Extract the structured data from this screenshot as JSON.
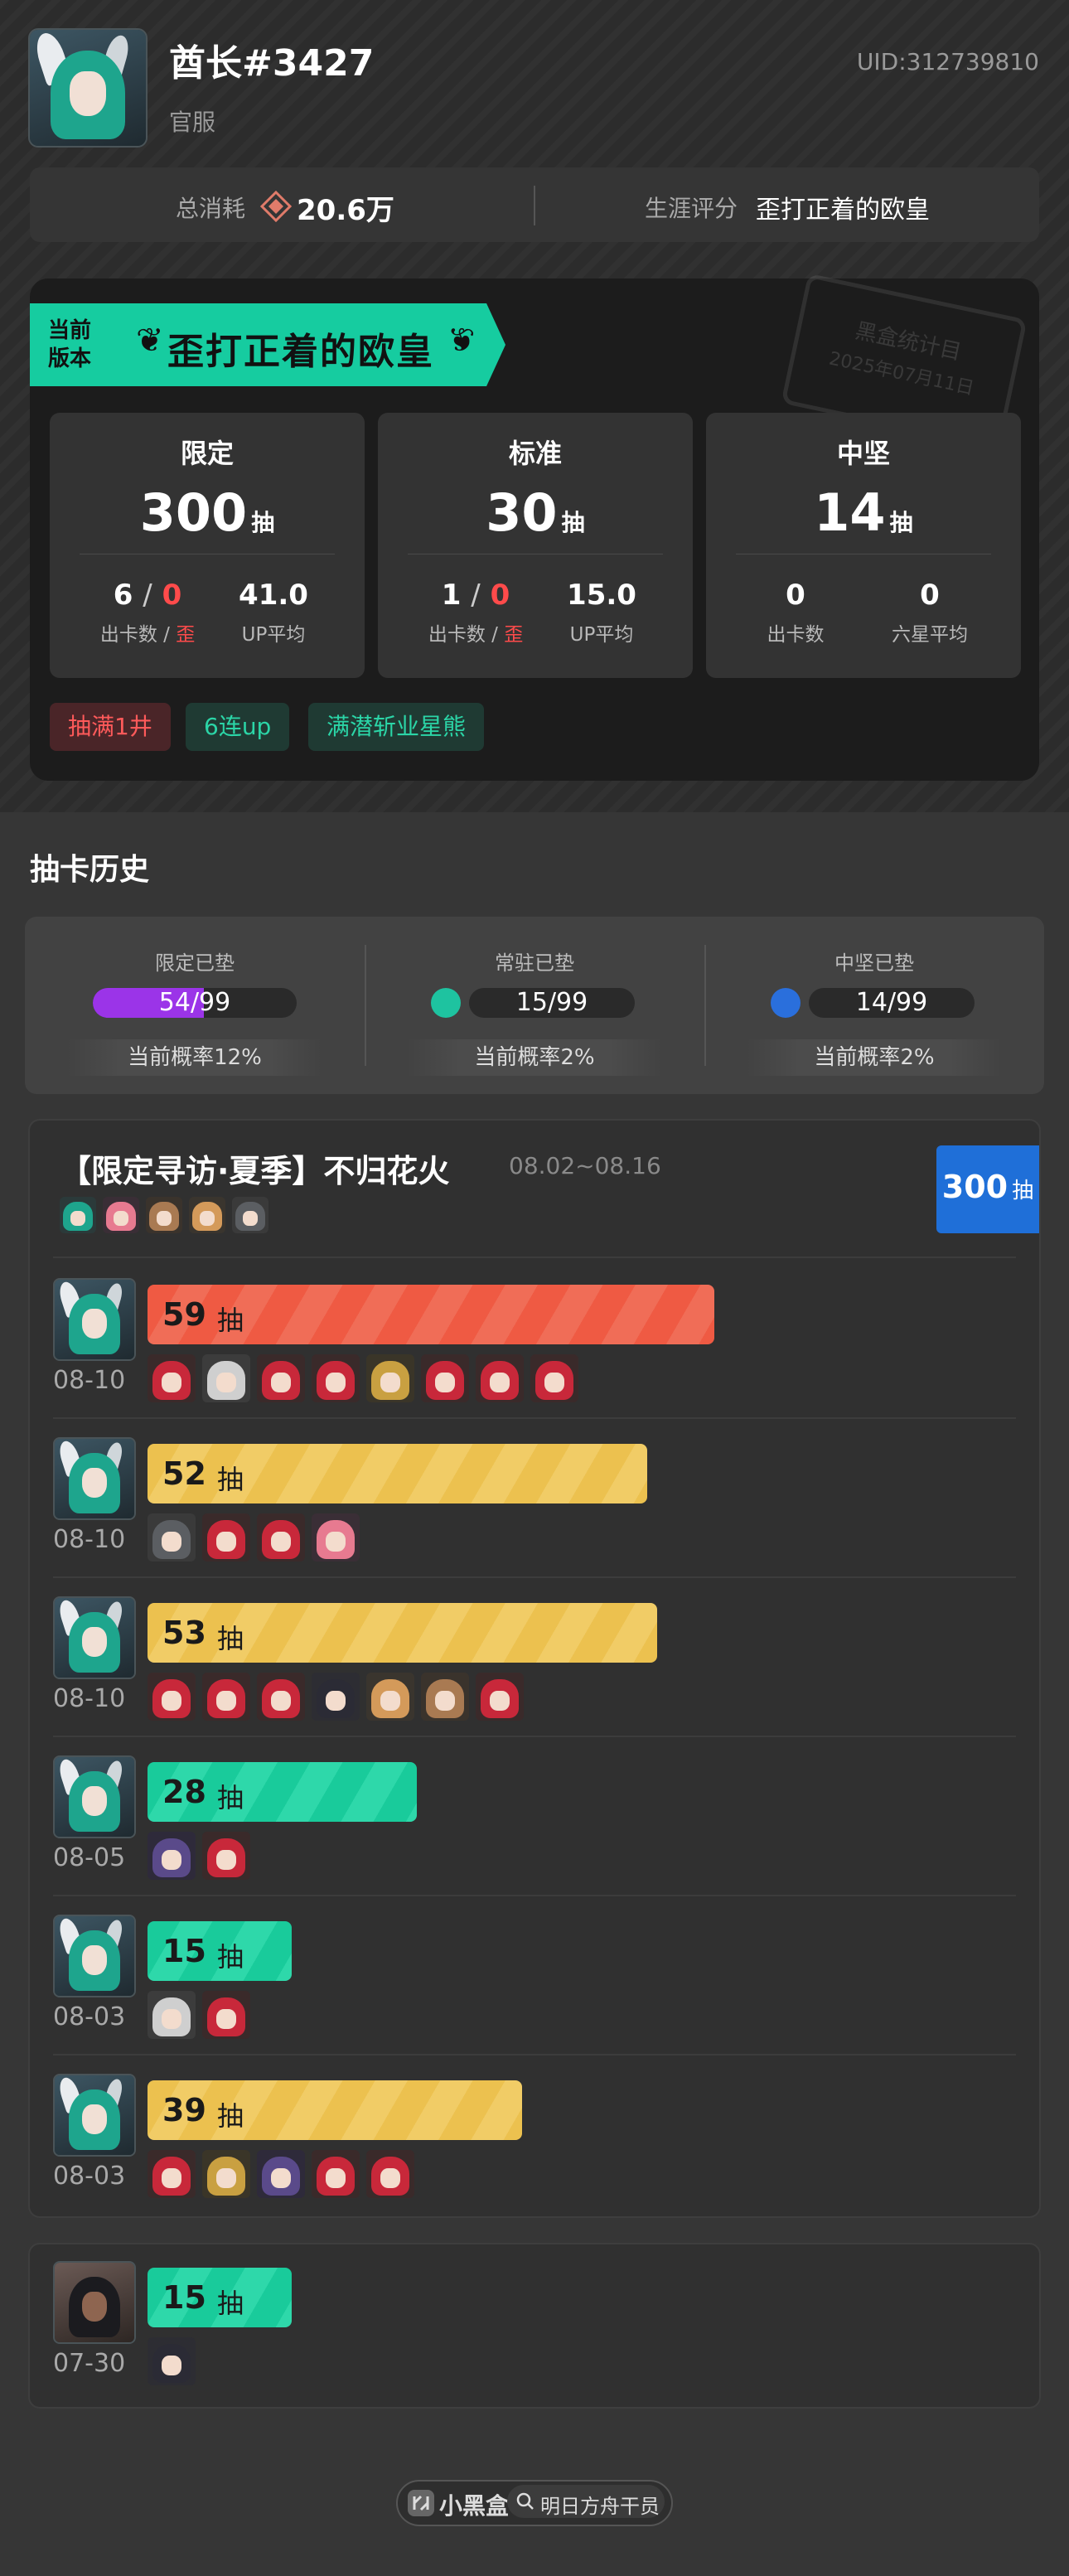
{
  "profile": {
    "nickname": "酋长#3427",
    "server": "官服",
    "uid": "UID:312739810",
    "total_spent_label": "总消耗",
    "total_spent_value": "20.6万",
    "career_label": "生涯评分",
    "career_value": "歪打正着的欧皇"
  },
  "version_card": {
    "current_label_line1": "当前",
    "current_label_line2": "版本",
    "title": "歪打正着的欧皇",
    "stamp_line1": "黑盒统计目",
    "stamp_line2": "2025年07月11日",
    "pools": [
      {
        "name": "限定",
        "count": "300",
        "unit": "抽",
        "a_val": "6",
        "a_red": "0",
        "a_sep": "/",
        "a_lbl": "出卡数",
        "a_lbl_red": "歪",
        "b_val": "41.0",
        "b_lbl": "UP平均"
      },
      {
        "name": "标准",
        "count": "30",
        "unit": "抽",
        "a_val": "1",
        "a_red": "0",
        "a_sep": "/",
        "a_lbl": "出卡数",
        "a_lbl_red": "歪",
        "b_val": "15.0",
        "b_lbl": "UP平均"
      },
      {
        "name": "中坚",
        "count": "14",
        "unit": "抽",
        "a_val": "0",
        "a_lbl": "出卡数",
        "b_val": "0",
        "b_lbl": "六星平均"
      }
    ],
    "tags": [
      "抽满1井",
      "6连up",
      "满潜斩业星熊"
    ]
  },
  "history": {
    "title": "抽卡历史",
    "pity": [
      {
        "label": "限定已垫",
        "value": "54/99",
        "ratio": 0.545,
        "color": "#9b34e8",
        "prob": "当前概率12%"
      },
      {
        "label": "常驻已垫",
        "value": "15/99",
        "ratio": 0.15,
        "color": "#1ec3a0",
        "prob": "当前概率2%"
      },
      {
        "label": "中坚已垫",
        "value": "14/99",
        "ratio": 0.14,
        "color": "#2a6fdc",
        "prob": "当前概率2%"
      }
    ],
    "banner": {
      "title": "【限定寻访·夏季】不归花火",
      "dates": "08.02~08.16",
      "total": "300",
      "total_unit": "抽"
    },
    "pull_unit": "抽",
    "rows": [
      {
        "pulls": 59,
        "date": "08-10",
        "color": "red"
      },
      {
        "pulls": 52,
        "date": "08-10",
        "color": "yellow"
      },
      {
        "pulls": 53,
        "date": "08-10",
        "color": "yellow"
      },
      {
        "pulls": 28,
        "date": "08-05",
        "color": "green"
      },
      {
        "pulls": 15,
        "date": "08-03",
        "color": "green"
      },
      {
        "pulls": 39,
        "date": "08-03",
        "color": "yellow"
      }
    ],
    "second_banner_row": {
      "pulls": 15,
      "date": "07-30",
      "color": "green"
    }
  },
  "footer": {
    "brand": "小黑盒",
    "query": "明日方舟干员"
  },
  "colors": {
    "accent_green": "#16cca0",
    "limited_purple": "#9b34e8",
    "bar_red": "#ef5a43",
    "bar_yellow": "#ecc14f",
    "bar_green": "#19cb9b",
    "badge_blue": "#1f6fd8"
  }
}
